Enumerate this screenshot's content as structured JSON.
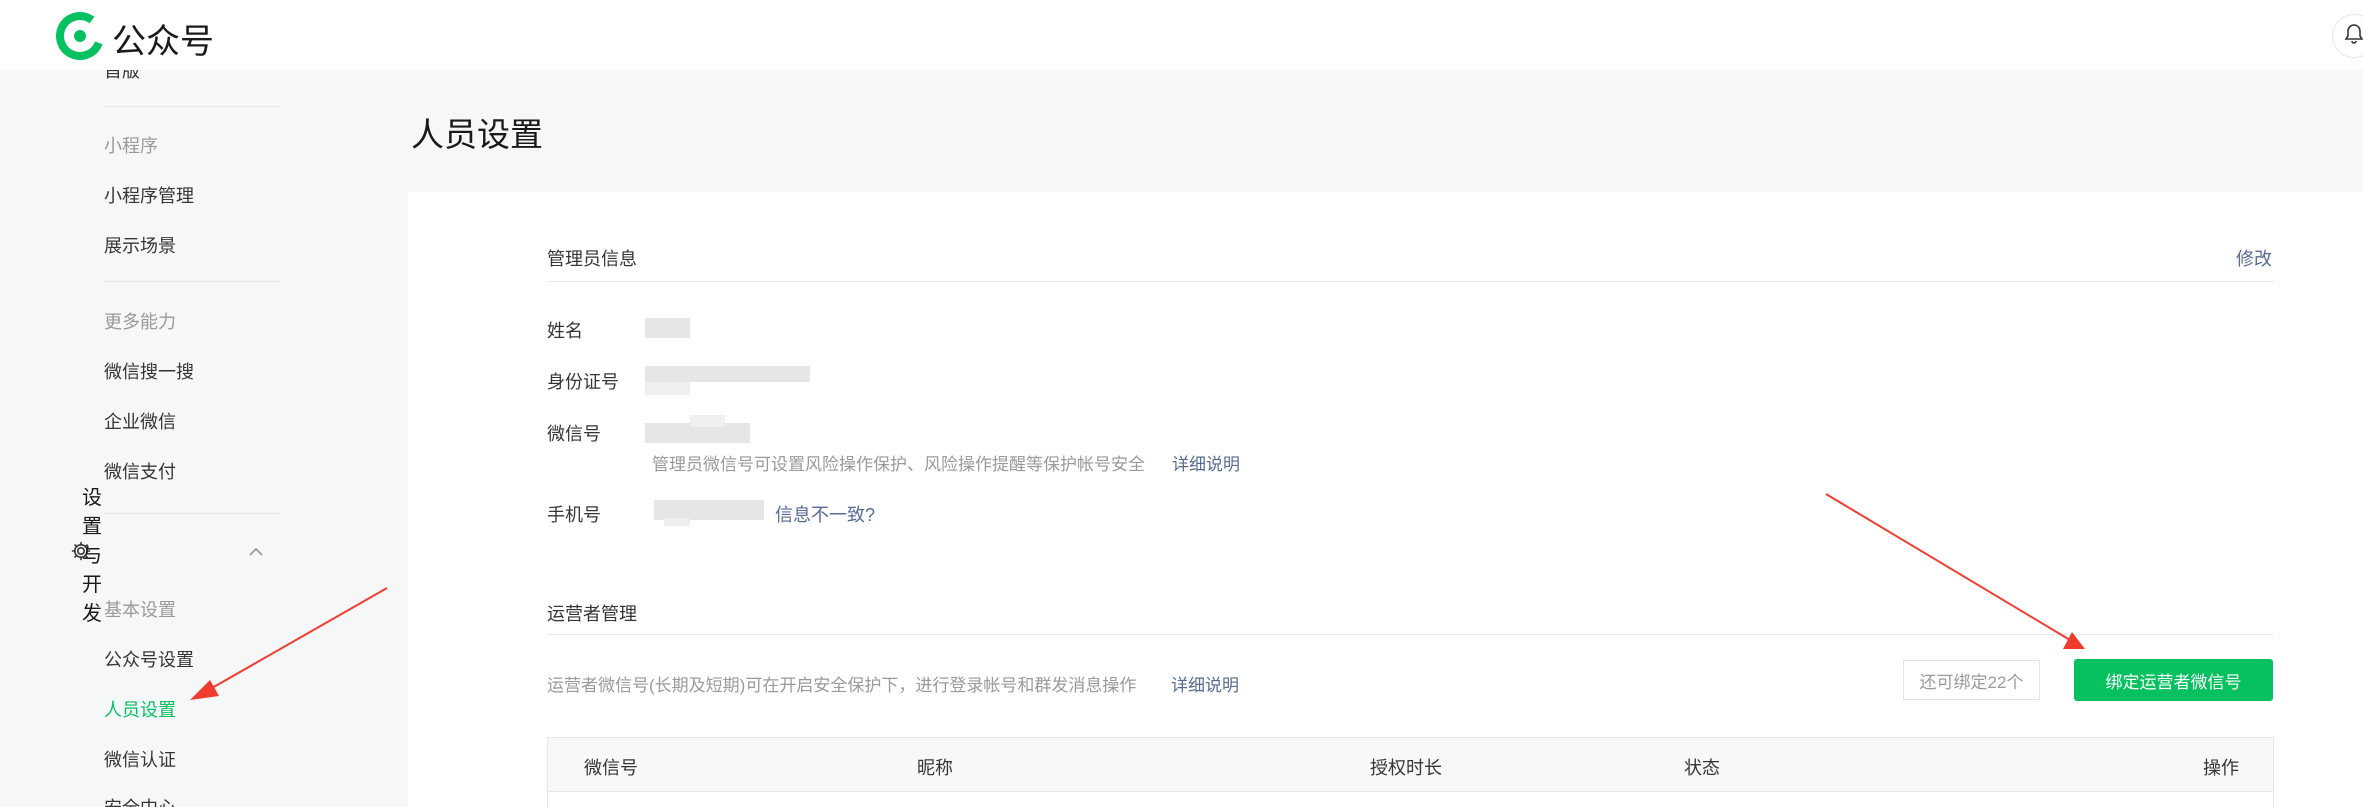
{
  "header": {
    "app_name": "公众号",
    "icons": {
      "logo": "wechat-official-logo",
      "bell": "bell-icon"
    },
    "brand_color": "#07c160"
  },
  "sidebar": {
    "partial_top_item": "首版",
    "groups": [
      {
        "category": "小程序",
        "items": [
          "小程序管理",
          "展示场景"
        ]
      },
      {
        "category": "更多能力",
        "items": [
          "微信搜一搜",
          "企业微信",
          "微信支付"
        ]
      }
    ],
    "section": {
      "title": "设置与开发",
      "icon": "gear-icon",
      "expand_icon": "chevron-up-icon",
      "category": "基本设置",
      "items": [
        "公众号设置",
        "人员设置",
        "微信认证"
      ],
      "active_item": "人员设置",
      "partial_bottom_item": "安全中心"
    }
  },
  "main": {
    "page_title": "人员设置",
    "admin": {
      "title": "管理员信息",
      "edit_link": "修改",
      "fields": {
        "name_label": "姓名",
        "id_label": "身份证号",
        "wechat_label": "微信号",
        "phone_label": "手机号"
      },
      "wechat_tip": "管理员微信号可设置风险操作保护、风险操作提醒等保护帐号安全",
      "wechat_tip_link": "详细说明",
      "phone_link": "信息不一致?"
    },
    "operators": {
      "title": "运营者管理",
      "tip": "运营者微信号(长期及短期)可在开启安全保护下，进行登录帐号和群发消息操作",
      "tip_link": "详细说明",
      "quota": "还可绑定22个",
      "bind_button": "绑定运营者微信号",
      "table_headers": [
        "微信号",
        "昵称",
        "授权时长",
        "状态",
        "操作"
      ]
    }
  },
  "annotations": {
    "arrow_color": "#f03c2e"
  }
}
